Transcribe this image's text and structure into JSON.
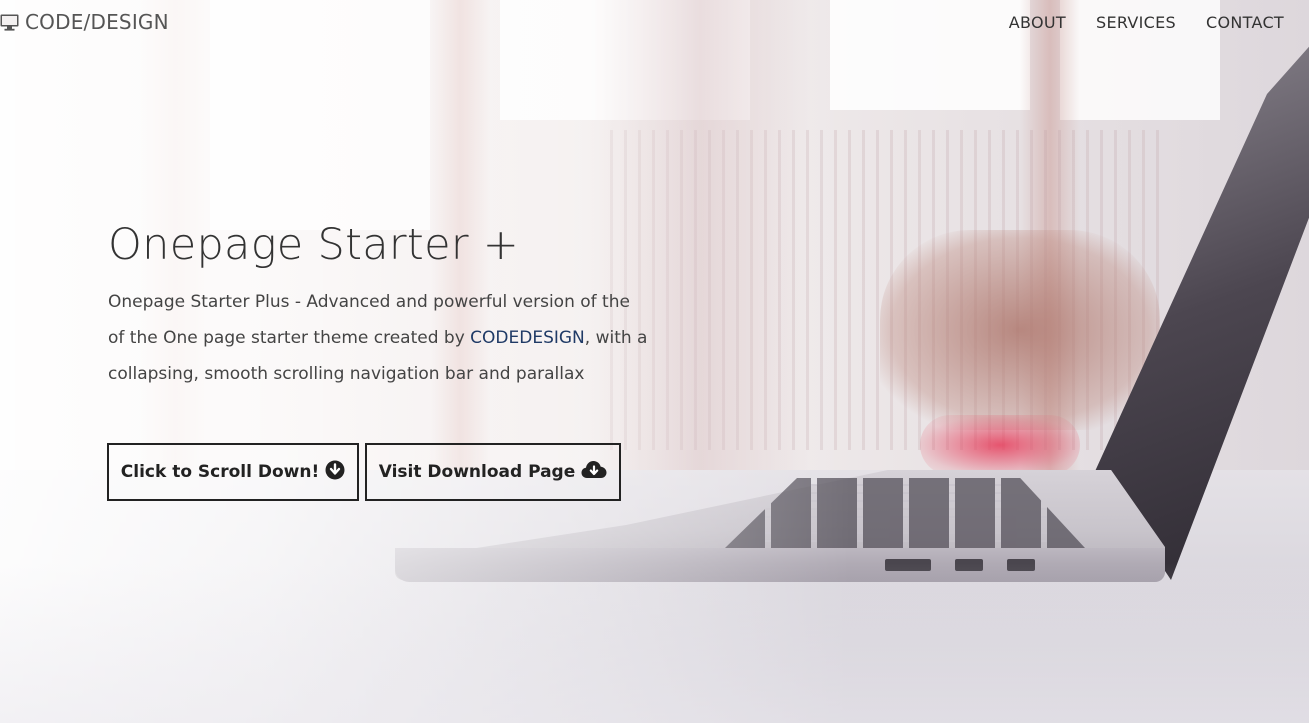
{
  "navbar": {
    "brand": "CODE/DESIGN",
    "brand_icon": "monitor-icon",
    "links": [
      {
        "label": "ABOUT"
      },
      {
        "label": "SERVICES"
      },
      {
        "label": "CONTACT"
      }
    ]
  },
  "hero": {
    "title": "Onepage Starter +",
    "text_part1": "Onepage Starter Plus - Advanced and powerful version of the of the One page starter theme created by ",
    "link_text": "CODEDESIGN",
    "text_part2": ", with a collapsing, smooth scrolling navigation bar and parallax"
  },
  "buttons": {
    "scroll": {
      "label": "Click to Scroll Down!",
      "icon": "arrow-circle-down-icon"
    },
    "download": {
      "label": "Visit Download Page",
      "icon": "cloud-download-icon"
    }
  },
  "colors": {
    "link": "#1f3a66",
    "text": "#333333",
    "button_border": "#222222"
  }
}
